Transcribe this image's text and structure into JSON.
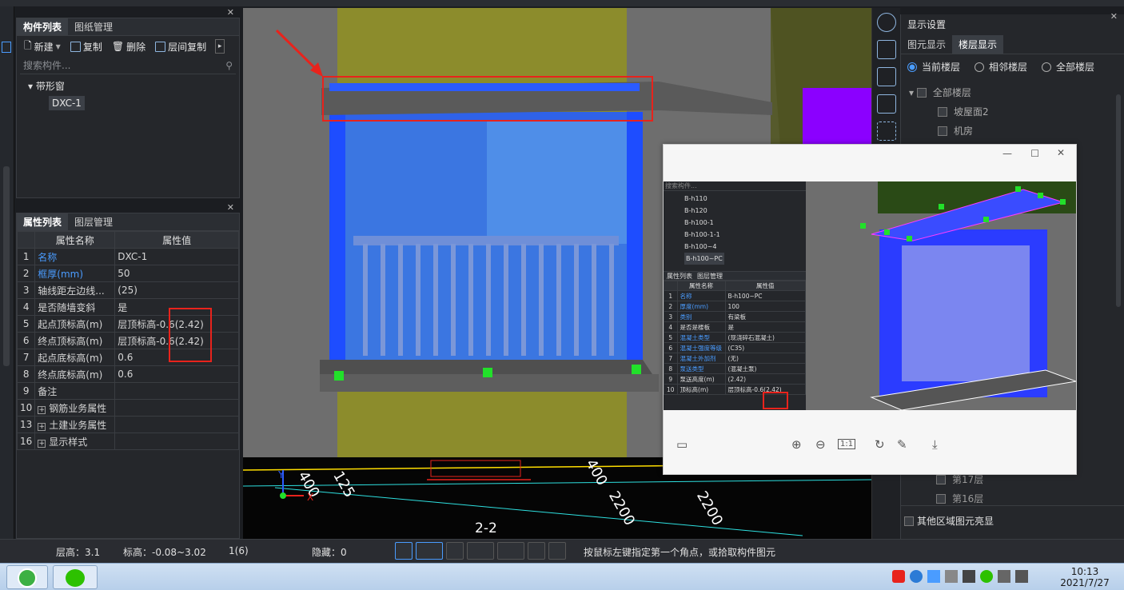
{
  "left_panel": {
    "tabs": [
      "构件列表",
      "图纸管理"
    ],
    "toolbar": {
      "new": "新建",
      "copy": "复制",
      "delete": "删除",
      "floor_copy": "层间复制"
    },
    "search_placeholder": "搜索构件...",
    "tree": {
      "group": "带形窗",
      "item": "DXC-1"
    }
  },
  "prop_panel": {
    "tabs": [
      "属性列表",
      "图层管理"
    ],
    "headers": [
      "属性名称",
      "属性值"
    ],
    "rows": [
      {
        "no": "1",
        "name": "名称",
        "value": "DXC-1"
      },
      {
        "no": "2",
        "name": "框厚(mm)",
        "value": "50"
      },
      {
        "no": "3",
        "name": "轴线距左边线...",
        "value": "(25)"
      },
      {
        "no": "4",
        "name": "是否随墙变斜",
        "value": "是"
      },
      {
        "no": "5",
        "name": "起点顶标高(m)",
        "value": "层顶标高-0.6(2.42)"
      },
      {
        "no": "6",
        "name": "终点顶标高(m)",
        "value": "层顶标高-0.6(2.42)"
      },
      {
        "no": "7",
        "name": "起点底标高(m)",
        "value": "0.6"
      },
      {
        "no": "8",
        "name": "终点底标高(m)",
        "value": "0.6"
      },
      {
        "no": "9",
        "name": "备注",
        "value": ""
      },
      {
        "no": "10",
        "name": "钢筋业务属性",
        "value": ""
      },
      {
        "no": "13",
        "name": "土建业务属性",
        "value": ""
      },
      {
        "no": "16",
        "name": "显示样式",
        "value": ""
      }
    ]
  },
  "viewport": {
    "dims": [
      "400",
      "125",
      "400",
      "2200",
      "2200"
    ],
    "section": "2-2",
    "axis_x": "X",
    "axis_y": "Y"
  },
  "right_panel": {
    "title": "显示设置",
    "tabs": [
      "图元显示",
      "楼层显示"
    ],
    "radios": [
      "当前楼层",
      "相邻楼层",
      "全部楼层"
    ],
    "tree_root": "全部楼层",
    "floors_top": [
      "坡屋面2",
      "机房"
    ],
    "floors_bottom": [
      "第17层",
      "第16层"
    ],
    "footer_check": "其他区域图元亮显"
  },
  "popup": {
    "list": [
      "B-h110",
      "B-h120",
      "B-h100-1",
      "B-h100-1-1",
      "B-h100~4",
      "B-h100~PC"
    ],
    "search_placeholder": "搜索构件...",
    "tabs": [
      "属性列表",
      "图层管理"
    ],
    "headers": [
      "属性名称",
      "属性值"
    ],
    "rows": [
      {
        "no": "1",
        "name": "名称",
        "value": "B-h100~PC"
      },
      {
        "no": "2",
        "name": "厚度(mm)",
        "value": "100"
      },
      {
        "no": "3",
        "name": "类别",
        "value": "有梁板"
      },
      {
        "no": "4",
        "name": "是否是楼板",
        "value": "是"
      },
      {
        "no": "5",
        "name": "混凝土类型",
        "value": "(现浇碎石混凝土)"
      },
      {
        "no": "6",
        "name": "混凝土强度等级",
        "value": "(C35)"
      },
      {
        "no": "7",
        "name": "混凝土外加剂",
        "value": "(无)"
      },
      {
        "no": "8",
        "name": "泵送类型",
        "value": "(混凝土泵)"
      },
      {
        "no": "9",
        "name": "泵送高度(m)",
        "value": "(2.42)"
      },
      {
        "no": "10",
        "name": "顶标高(m)",
        "value": "层顶标高-0.6(2.42)"
      }
    ],
    "zoom_label": "1:1"
  },
  "status": {
    "floor_height": "层高：3.1",
    "elevation": "标高：-0.08~3.02",
    "count": "1(6)",
    "hidden": "隐藏：0",
    "hint": "按鼠标左键指定第一个角点，或拾取构件图元"
  },
  "taskbar": {
    "time": "10:13",
    "date": "2021/7/27"
  },
  "colors": {
    "accent": "#4a9cff",
    "highlight": "#e8231c",
    "window_blue": "#2b5bff",
    "wall_yellow": "#8a8a2a",
    "purple": "#8b00ff"
  }
}
